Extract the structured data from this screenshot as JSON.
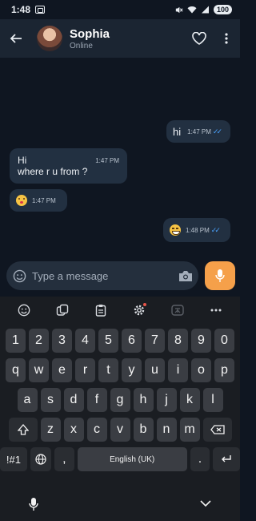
{
  "status_bar": {
    "time": "1:48",
    "battery": "100"
  },
  "header": {
    "contact_name": "Sophia",
    "contact_status": "Online"
  },
  "messages": [
    {
      "direction": "outgoing",
      "text": "hi",
      "time": "1:47 PM",
      "read": true
    },
    {
      "direction": "incoming",
      "lines": [
        "Hi",
        "where r u from ?"
      ],
      "time": "1:47 PM"
    },
    {
      "direction": "incoming",
      "emoji": "kissing-heart",
      "time": "1:47 PM"
    },
    {
      "direction": "outgoing",
      "emoji": "grinning",
      "time": "1:48 PM",
      "read": true
    }
  ],
  "composer": {
    "placeholder": "Type a message"
  },
  "keyboard": {
    "row_numbers": [
      "1",
      "2",
      "3",
      "4",
      "5",
      "6",
      "7",
      "8",
      "9",
      "0"
    ],
    "row_1": [
      "q",
      "w",
      "e",
      "r",
      "t",
      "y",
      "u",
      "i",
      "o",
      "p"
    ],
    "row_2": [
      "a",
      "s",
      "d",
      "f",
      "g",
      "h",
      "j",
      "k",
      "l"
    ],
    "row_3": [
      "z",
      "x",
      "c",
      "v",
      "b",
      "n",
      "m"
    ],
    "symbols_label": "!#1",
    "comma_label": ",",
    "space_label": "English (UK)",
    "period_label": "."
  },
  "colors": {
    "accent": "#f5a04a",
    "read_tick": "#4aa3ff",
    "bubble": "#223041",
    "background": "#0f1621"
  }
}
